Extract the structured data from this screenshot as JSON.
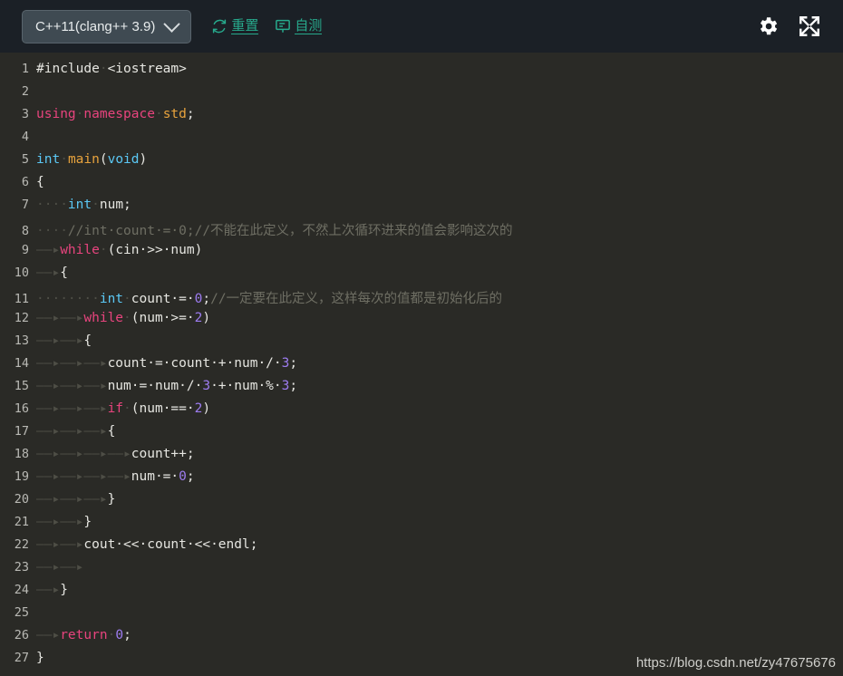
{
  "toolbar": {
    "language_label": "C++11(clang++ 3.9)",
    "chevron_icon": "chevron-down-icon",
    "reset_label": "重置",
    "reset_icon": "refresh-icon",
    "selftest_label": "自测",
    "selftest_icon": "monitor-icon",
    "settings_icon": "gear-icon",
    "fullscreen_icon": "expand-icon",
    "accent_color": "#27a98c",
    "background_color": "#1b2026"
  },
  "editor": {
    "background_color": "#2a2a26",
    "line_number_color": "#b9b9b4",
    "lines": [
      {
        "n": "1",
        "tokens": [
          {
            "t": "#include",
            "c": "pre"
          },
          {
            "t": "·",
            "c": "dot"
          },
          {
            "t": "<iostream>",
            "c": "pre"
          }
        ]
      },
      {
        "n": "2",
        "tokens": []
      },
      {
        "n": "3",
        "tokens": [
          {
            "t": "using",
            "c": "kw"
          },
          {
            "t": "·",
            "c": "dot"
          },
          {
            "t": "namespace",
            "c": "kw"
          },
          {
            "t": "·",
            "c": "dot"
          },
          {
            "t": "std",
            "c": "fn"
          },
          {
            "t": ";",
            "c": "pre"
          }
        ]
      },
      {
        "n": "4",
        "tokens": []
      },
      {
        "n": "5",
        "tokens": [
          {
            "t": "int",
            "c": "typ"
          },
          {
            "t": "·",
            "c": "dot"
          },
          {
            "t": "main",
            "c": "fn"
          },
          {
            "t": "(",
            "c": "pre"
          },
          {
            "t": "void",
            "c": "typ"
          },
          {
            "t": ")",
            "c": "pre"
          }
        ]
      },
      {
        "n": "6",
        "tokens": [
          {
            "t": "{",
            "c": "pre"
          }
        ]
      },
      {
        "n": "7",
        "tokens": [
          {
            "t": "····",
            "c": "dot"
          },
          {
            "t": "int",
            "c": "typ"
          },
          {
            "t": "·",
            "c": "dot"
          },
          {
            "t": "num;",
            "c": "pre"
          }
        ]
      },
      {
        "n": "8",
        "tokens": [
          {
            "t": "····",
            "c": "dot"
          },
          {
            "t": "//int·count·=·0;//不能在此定义，不然上次循环进来的值会影响这次的",
            "c": "cmt"
          }
        ]
      },
      {
        "n": "9",
        "tokens": [
          {
            "t": "——▸",
            "c": "tab"
          },
          {
            "t": "while",
            "c": "kw"
          },
          {
            "t": "·",
            "c": "dot"
          },
          {
            "t": "(cin·>>·num)",
            "c": "pre"
          }
        ]
      },
      {
        "n": "10",
        "tokens": [
          {
            "t": "——▸",
            "c": "tab"
          },
          {
            "t": "{",
            "c": "pre"
          }
        ]
      },
      {
        "n": "11",
        "tokens": [
          {
            "t": "········",
            "c": "dot"
          },
          {
            "t": "int",
            "c": "typ"
          },
          {
            "t": "·",
            "c": "dot"
          },
          {
            "t": "count·=·",
            "c": "pre"
          },
          {
            "t": "0",
            "c": "num"
          },
          {
            "t": ";",
            "c": "pre"
          },
          {
            "t": "//一定要在此定义，这样每次的值都是初始化后的",
            "c": "cmt"
          }
        ]
      },
      {
        "n": "12",
        "tokens": [
          {
            "t": "——▸——▸",
            "c": "tab"
          },
          {
            "t": "while",
            "c": "kw"
          },
          {
            "t": "·",
            "c": "dot"
          },
          {
            "t": "(num·>=·",
            "c": "pre"
          },
          {
            "t": "2",
            "c": "num"
          },
          {
            "t": ")",
            "c": "pre"
          }
        ]
      },
      {
        "n": "13",
        "tokens": [
          {
            "t": "——▸——▸",
            "c": "tab"
          },
          {
            "t": "{",
            "c": "pre"
          }
        ]
      },
      {
        "n": "14",
        "tokens": [
          {
            "t": "——▸——▸——▸",
            "c": "tab"
          },
          {
            "t": "count·=·count·+·num·/·",
            "c": "pre"
          },
          {
            "t": "3",
            "c": "num"
          },
          {
            "t": ";",
            "c": "pre"
          }
        ]
      },
      {
        "n": "15",
        "tokens": [
          {
            "t": "——▸——▸——▸",
            "c": "tab"
          },
          {
            "t": "num·=·num·/·",
            "c": "pre"
          },
          {
            "t": "3",
            "c": "num"
          },
          {
            "t": "·+·num·%·",
            "c": "pre"
          },
          {
            "t": "3",
            "c": "num"
          },
          {
            "t": ";",
            "c": "pre"
          }
        ]
      },
      {
        "n": "16",
        "tokens": [
          {
            "t": "——▸——▸——▸",
            "c": "tab"
          },
          {
            "t": "if",
            "c": "kw"
          },
          {
            "t": "·",
            "c": "dot"
          },
          {
            "t": "(num·==·",
            "c": "pre"
          },
          {
            "t": "2",
            "c": "num"
          },
          {
            "t": ")",
            "c": "pre"
          }
        ]
      },
      {
        "n": "17",
        "tokens": [
          {
            "t": "——▸——▸——▸",
            "c": "tab"
          },
          {
            "t": "{",
            "c": "pre"
          }
        ]
      },
      {
        "n": "18",
        "tokens": [
          {
            "t": "——▸——▸——▸——▸",
            "c": "tab"
          },
          {
            "t": "count++;",
            "c": "pre"
          }
        ]
      },
      {
        "n": "19",
        "tokens": [
          {
            "t": "——▸——▸——▸——▸",
            "c": "tab"
          },
          {
            "t": "num·=·",
            "c": "pre"
          },
          {
            "t": "0",
            "c": "num"
          },
          {
            "t": ";",
            "c": "pre"
          }
        ]
      },
      {
        "n": "20",
        "tokens": [
          {
            "t": "——▸——▸——▸",
            "c": "tab"
          },
          {
            "t": "}",
            "c": "pre"
          }
        ]
      },
      {
        "n": "21",
        "tokens": [
          {
            "t": "——▸——▸",
            "c": "tab"
          },
          {
            "t": "}",
            "c": "pre"
          }
        ]
      },
      {
        "n": "22",
        "tokens": [
          {
            "t": "——▸——▸",
            "c": "tab"
          },
          {
            "t": "cout·<<·count·<<·endl;",
            "c": "pre"
          }
        ]
      },
      {
        "n": "23",
        "tokens": [
          {
            "t": "——▸——▸",
            "c": "tab"
          }
        ]
      },
      {
        "n": "24",
        "tokens": [
          {
            "t": "——▸",
            "c": "tab"
          },
          {
            "t": "}",
            "c": "pre"
          }
        ]
      },
      {
        "n": "25",
        "tokens": []
      },
      {
        "n": "26",
        "tokens": [
          {
            "t": "——▸",
            "c": "tab"
          },
          {
            "t": "return",
            "c": "kw"
          },
          {
            "t": "·",
            "c": "dot"
          },
          {
            "t": "0",
            "c": "num"
          },
          {
            "t": ";",
            "c": "pre"
          }
        ]
      },
      {
        "n": "27",
        "tokens": [
          {
            "t": "}",
            "c": "pre"
          }
        ]
      }
    ]
  },
  "watermark": {
    "text": "https://blog.csdn.net/zy47675676"
  }
}
